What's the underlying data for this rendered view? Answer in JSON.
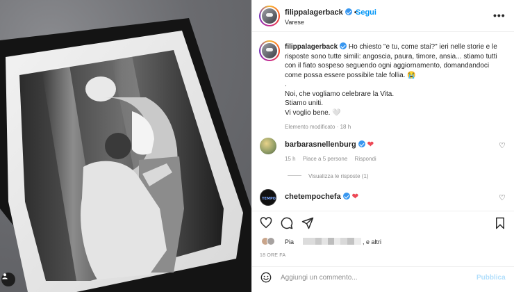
{
  "header": {
    "username": "filippalagerback",
    "dot": "•",
    "follow_label": "Segui",
    "location": "Varese",
    "more_icon": "more-horizontal-icon"
  },
  "caption": {
    "username": "filippalagerback",
    "line1": "Ho chiesto \"e tu, come stai?\" ieri nelle storie e le risposte sono tutte simili: angoscia, paura, timore, ansia... stiamo tutti con il fiato sospeso seguendo ogni aggiornamento, domandandoci come possa essere possibile tale follia. 😭",
    "line2": ".",
    "line3": "Noi, che vogliamo celebrare la Vita.",
    "line4": "Stiamo uniti.",
    "line5": "Vi voglio bene. 🤍",
    "meta": "Elemento modificato · 18 h"
  },
  "comments": [
    {
      "username": "barbarasnellenburg",
      "heart": "❤",
      "time": "15 h",
      "likes": "Piace a 5 persone",
      "reply": "Rispondi",
      "view_replies": "Visualizza le risposte (1)"
    },
    {
      "username": "chetempochefa",
      "heart": "❤"
    }
  ],
  "actions": {
    "likes_prefix": "Pia",
    "likes_suffix": ", e altri",
    "time_ago": "18 ORE FA",
    "comment_placeholder": "Aggiungi un commento...",
    "publish_label": "Pubblica"
  },
  "colors": {
    "accent": "#0095f6",
    "heart": "#ed4956",
    "verified": "#3897f0"
  }
}
